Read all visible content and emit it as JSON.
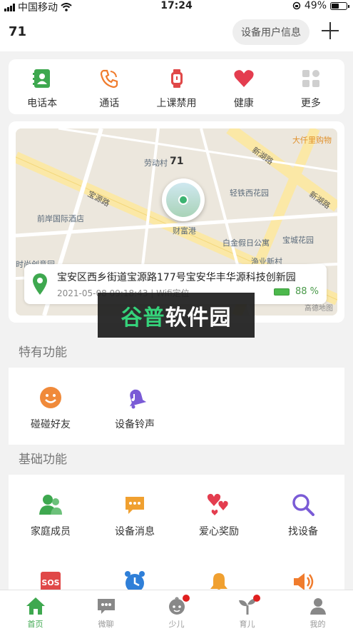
{
  "status_bar": {
    "carrier": "中国移动",
    "time": "17:24",
    "battery": "49%"
  },
  "header": {
    "title": "71",
    "device_info_button": "设备用户信息",
    "add_icon": "plus-icon"
  },
  "quick_actions": [
    {
      "label": "电话本",
      "icon": "phonebook-icon",
      "color": "#3ea84f"
    },
    {
      "label": "通话",
      "icon": "phone-icon",
      "color": "#f07c2d"
    },
    {
      "label": "上课禁用",
      "icon": "watch-icon",
      "color": "#e04848"
    },
    {
      "label": "健康",
      "icon": "heart-icon",
      "color": "#e43d4f"
    },
    {
      "label": "更多",
      "icon": "grid-icon",
      "color": "#bbbbbb"
    }
  ],
  "map": {
    "places": [
      "劳动村",
      "71",
      "轻铁西花园",
      "前岸国际酒店",
      "财富港",
      "白金假日公寓",
      "宝城花园",
      "大仟里购物",
      "渔业新村",
      "时尚创意园"
    ],
    "roads": [
      "新湖路",
      "宝源路",
      "新湖路"
    ],
    "provider": "高德地图"
  },
  "location": {
    "address": "宝安区西乡街道宝源路177号宝安华丰华源科技创新园",
    "time": "2021-05-08 09:18:43 | Wifi定位",
    "battery_percent": "88 %"
  },
  "watermark": {
    "green": "谷普",
    "white": "软件园"
  },
  "special_features": {
    "title": "特有功能",
    "items": [
      {
        "label": "碰碰好友",
        "icon": "smile-face-icon",
        "color": "#f08a3a"
      },
      {
        "label": "设备铃声",
        "icon": "bell-music-icon",
        "color": "#7a5bd6"
      }
    ]
  },
  "basic_features": {
    "title": "基础功能",
    "items": [
      {
        "label": "家庭成员",
        "icon": "family-members-icon",
        "color": "#3ea84f"
      },
      {
        "label": "设备消息",
        "icon": "message-icon",
        "color": "#f0a030"
      },
      {
        "label": "爱心奖励",
        "icon": "hearts-icon",
        "color": "#e43d4f"
      },
      {
        "label": "找设备",
        "icon": "search-icon",
        "color": "#7a5bd6"
      }
    ],
    "partial_items": [
      "sos-icon",
      "alarm-clock-icon",
      "bell-icon",
      "speaker-icon"
    ]
  },
  "tabbar": [
    {
      "label": "首页",
      "icon": "home-icon",
      "active": true,
      "badge": false
    },
    {
      "label": "微聊",
      "icon": "chat-icon",
      "active": false,
      "badge": false
    },
    {
      "label": "少儿",
      "icon": "child-icon",
      "active": false,
      "badge": true
    },
    {
      "label": "育儿",
      "icon": "sprout-icon",
      "active": false,
      "badge": true
    },
    {
      "label": "我的",
      "icon": "profile-icon",
      "active": false,
      "badge": false
    }
  ]
}
